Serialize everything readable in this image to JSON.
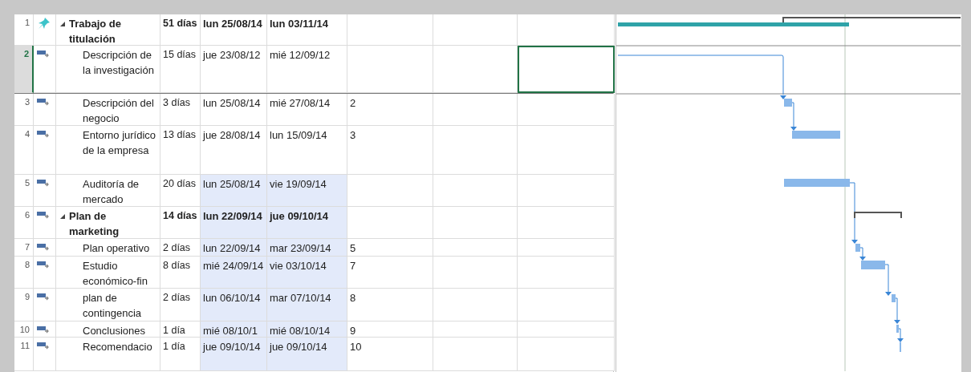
{
  "rows": [
    {
      "id": "1",
      "kind": "pinned",
      "name": "Trabajo de titulación",
      "duration": "51 días",
      "start": "lun 25/08/14",
      "finish": "lun 03/11/14",
      "predecessors": "",
      "summary": true,
      "expanded": true,
      "selected": false,
      "highlight": false
    },
    {
      "id": "2",
      "kind": "auto",
      "name": "Descripción de la investigación",
      "duration": "15 días",
      "start": "jue 23/08/12",
      "finish": "mié 12/09/12",
      "predecessors": "",
      "summary": false,
      "selected": true,
      "highlight": false
    },
    {
      "id": "3",
      "kind": "auto",
      "name": "Descripción del negocio",
      "duration": "3 días",
      "start": "lun 25/08/14",
      "finish": "mié 27/08/14",
      "predecessors": "2",
      "summary": false,
      "selected": false,
      "highlight": false
    },
    {
      "id": "4",
      "kind": "auto",
      "name": "Entorno jurídico de la empresa",
      "duration": "13 días",
      "start": "jue 28/08/14",
      "finish": "lun 15/09/14",
      "predecessors": "3",
      "summary": false,
      "selected": false,
      "highlight": false
    },
    {
      "id": "5",
      "kind": "auto",
      "name": "Auditoría de mercado",
      "duration": "20 días",
      "start": "lun 25/08/14",
      "finish": "vie 19/09/14",
      "predecessors": "",
      "summary": false,
      "selected": false,
      "highlight": true
    },
    {
      "id": "6",
      "kind": "auto",
      "name": "Plan de marketing",
      "duration": "14 días",
      "start": "lun 22/09/14",
      "finish": "jue 09/10/14",
      "predecessors": "",
      "summary": true,
      "expanded": true,
      "selected": false,
      "highlight": true
    },
    {
      "id": "7",
      "kind": "auto",
      "name": "Plan operativo",
      "duration": "2 días",
      "start": "lun 22/09/14",
      "finish": "mar 23/09/14",
      "predecessors": "5",
      "summary": false,
      "selected": false,
      "highlight": true
    },
    {
      "id": "8",
      "kind": "auto",
      "name": "Estudio económico-fin",
      "duration": "8 días",
      "start": "mié 24/09/14",
      "finish": "vie 03/10/14",
      "predecessors": "7",
      "summary": false,
      "selected": false,
      "highlight": true
    },
    {
      "id": "9",
      "kind": "auto",
      "name": "plan de contingencia",
      "duration": "2 días",
      "start": "lun 06/10/14",
      "finish": "mar 07/10/14",
      "predecessors": "8",
      "summary": false,
      "selected": false,
      "highlight": true
    },
    {
      "id": "10",
      "kind": "auto",
      "name": "Conclusiones",
      "duration": "1 día",
      "start": "mié 08/10/1",
      "finish": "mié 08/10/14",
      "predecessors": "9",
      "summary": false,
      "selected": false,
      "highlight": true
    },
    {
      "id": "11",
      "kind": "auto",
      "name": "Recomendacio",
      "duration": "1 día",
      "start": "jue 09/10/14",
      "finish": "jue 09/10/14",
      "predecessors": "10",
      "summary": false,
      "selected": false,
      "highlight": true
    }
  ]
}
